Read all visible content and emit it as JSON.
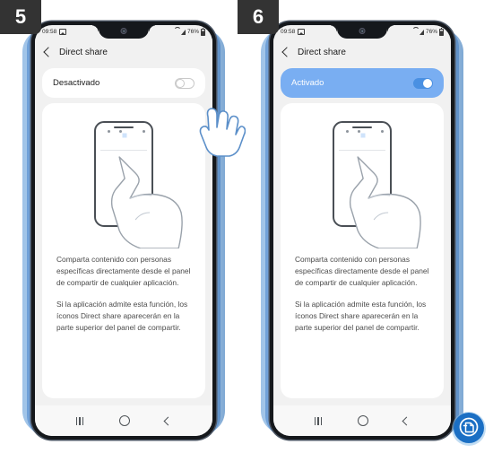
{
  "steps": [
    {
      "badge": "5",
      "status": {
        "time": "09:58",
        "battery": "76%",
        "image_icon": "image-icon",
        "wifi_icon": "wifi-icon",
        "signal_icon": "signal-icon",
        "battery_icon": "battery-icon"
      },
      "appbar": {
        "back_icon": "back-arrow-icon",
        "title": "Direct share"
      },
      "toggle": {
        "label": "Desactivado",
        "state": "off"
      },
      "illustration": {
        "name": "direct-share-illustration",
        "alt": "Mano tocando un ícono de contacto en el panel de compartir"
      },
      "body": [
        "Comparta contenido con personas específicas directamente desde el panel de compartir de cualquier aplicación.",
        "Si la aplicación admite esta función, los íconos Direct share aparecerán en la parte superior del panel de compartir."
      ],
      "nav": {
        "recents": "recents-icon",
        "home": "home-icon",
        "back": "back-icon"
      },
      "cursor": "pointing-hand-cursor"
    },
    {
      "badge": "6",
      "status": {
        "time": "09:58",
        "battery": "76%",
        "image_icon": "image-icon",
        "wifi_icon": "wifi-icon",
        "signal_icon": "signal-icon",
        "battery_icon": "battery-icon"
      },
      "appbar": {
        "back_icon": "back-arrow-icon",
        "title": "Direct share"
      },
      "toggle": {
        "label": "Activado",
        "state": "on"
      },
      "illustration": {
        "name": "direct-share-illustration",
        "alt": "Mano tocando un ícono de contacto en el panel de compartir"
      },
      "body": [
        "Comparta contenido con personas específicas directamente desde el panel de compartir de cualquier aplicación.",
        "Si la aplicación admite esta función, los íconos Direct share aparecerán en la parte superior del panel de compartir."
      ],
      "nav": {
        "recents": "recents-icon",
        "home": "home-icon",
        "back": "back-icon"
      },
      "cursor": null
    }
  ],
  "fab": {
    "icon": "document-page-icon"
  },
  "colors": {
    "badge_bg": "#333333",
    "toggle_on_row": "#79aef2",
    "toggle_on_switch": "#4a90e2",
    "accent_blue": "#3f8de8",
    "fab_blue": "#1b6fc4",
    "screen_bg": "#f1f1f1",
    "card_bg": "#ffffff",
    "text": "#1b1b1b",
    "body_text": "#4b4b4b"
  }
}
